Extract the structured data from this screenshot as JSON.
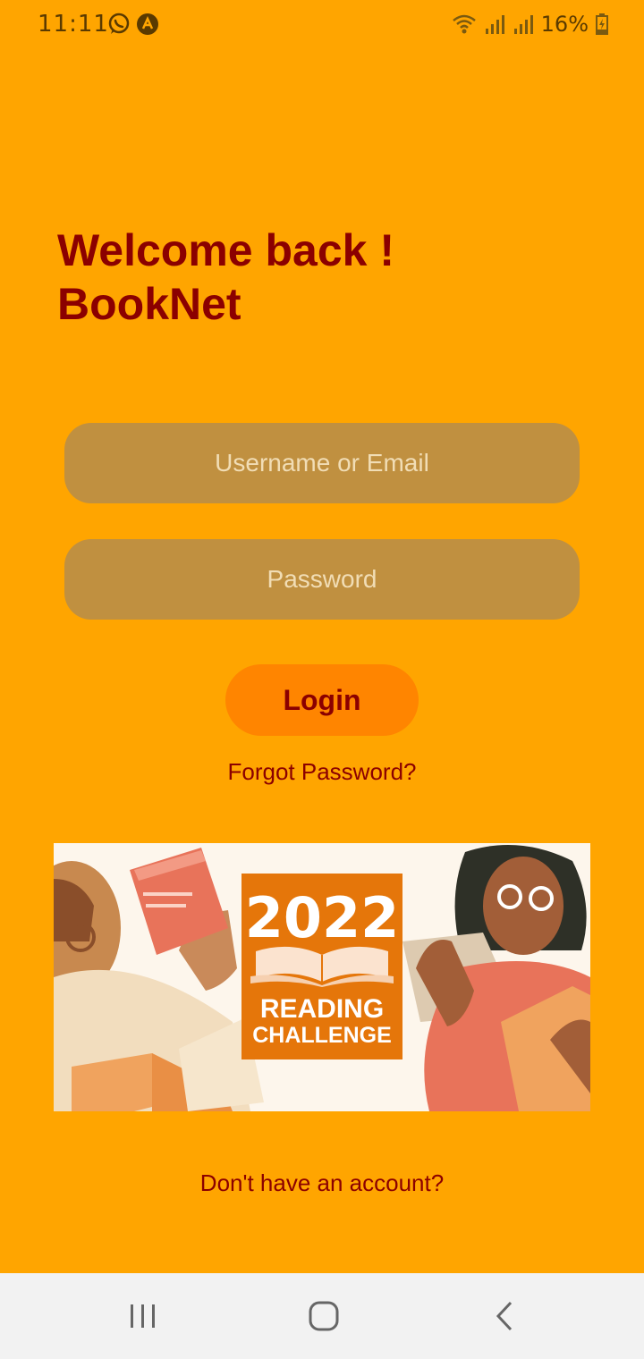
{
  "status_bar": {
    "time": "11:11",
    "battery": "16%",
    "icons": [
      "whatsapp-icon",
      "app-notification-icon",
      "wifi-icon",
      "signal-icon",
      "signal-icon",
      "battery-charging-icon"
    ]
  },
  "header": {
    "title_line1": "Welcome back !",
    "title_line2": "BookNet"
  },
  "form": {
    "username_placeholder": "Username or Email",
    "password_placeholder": "Password",
    "login_label": "Login",
    "forgot_label": "Forgot Password?"
  },
  "banner": {
    "year": "2022",
    "line1": "READING",
    "line2": "CHALLENGE"
  },
  "footer": {
    "signup_label": "Don't have an account?"
  },
  "colors": {
    "background": "#FFA500",
    "title": "#8B0000",
    "field": "#C09040",
    "button": "#FF8500",
    "badge": "#E5760A"
  },
  "nav": [
    "recent-apps-icon",
    "home-icon",
    "back-icon"
  ]
}
